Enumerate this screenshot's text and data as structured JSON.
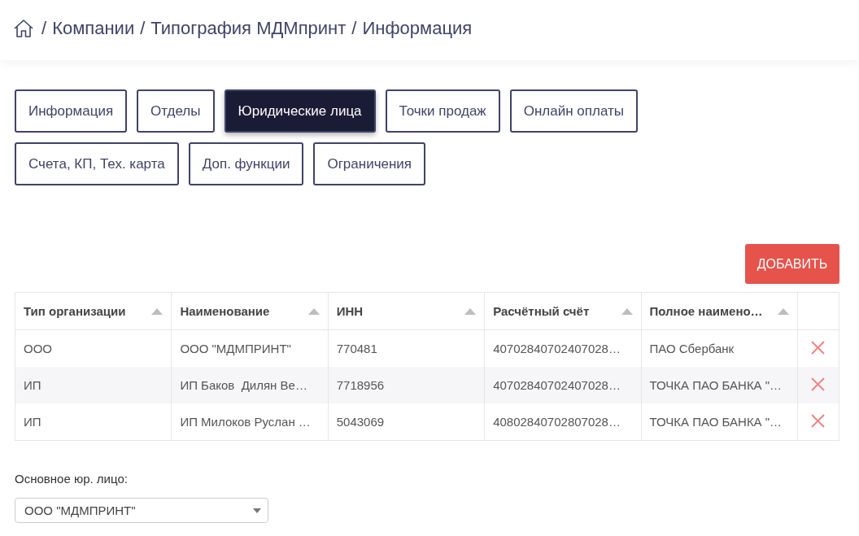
{
  "breadcrumb": {
    "separator": "/",
    "items": [
      "Компании",
      "Типография МДМпринт",
      "Информация"
    ]
  },
  "tabs": [
    {
      "label": "Информация",
      "selected": false
    },
    {
      "label": "Отделы",
      "selected": false
    },
    {
      "label": "Юридические лица",
      "selected": true
    },
    {
      "label": "Точки продаж",
      "selected": false
    },
    {
      "label": "Онлайн оплаты",
      "selected": false
    },
    {
      "label": "Счета, КП, Тех. карта",
      "selected": false
    },
    {
      "label": "Доп. функции",
      "selected": false
    },
    {
      "label": "Ограничения",
      "selected": false
    }
  ],
  "add_button": "ДОБАВИТЬ",
  "table": {
    "columns": [
      "Тип организации",
      "Наименование",
      "ИНН",
      "Расчётный счёт",
      "Полное наимено…"
    ],
    "rows": [
      [
        "ООО",
        "ООО \"МДМПРИНТ\"",
        "770481",
        "40702840702407028…",
        "ПАО Сбербанк"
      ],
      [
        "ИП",
        "ИП Баков  Дилян Ве…",
        "7718956",
        "40702840702407028…",
        "ТОЧКА ПАО БАНКА \"…"
      ],
      [
        "ИП",
        "ИП Милоков Руслан …",
        "5043069",
        "40802840702807028…",
        "ТОЧКА ПАО БАНКА \"…"
      ]
    ]
  },
  "main_entity": {
    "label": "Основное юр. лицо:",
    "value": "ООО \"МДМПРИНТ\""
  }
}
